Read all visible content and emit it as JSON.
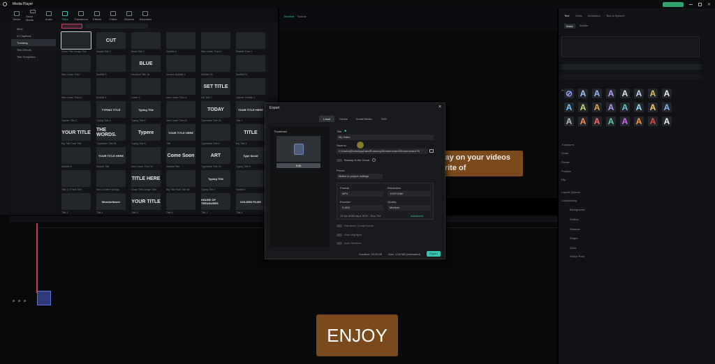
{
  "app": {
    "title": "Media Player"
  },
  "toolbar": [
    "Media",
    "Stock Media",
    "Audio",
    "Titles",
    "Transitions",
    "Effects",
    "Filters",
    "Stickers",
    "Templates"
  ],
  "sidebar": [
    "Mine",
    "AI Captions",
    "Trending",
    "Title Effects",
    "Title Templates"
  ],
  "library": {
    "titles": [
      {
        "t": "",
        "l": "Clean Title Design Title"
      },
      {
        "t": "CUT",
        "l": "Impact Title 1"
      },
      {
        "t": "",
        "l": "Basic Title 2"
      },
      {
        "t": "",
        "l": "Subtitle 4"
      },
      {
        "t": "",
        "l": "New Lower Third 1"
      },
      {
        "t": "",
        "l": "Subtitle Pack 1"
      },
      {
        "t": "",
        "l": "New Lower Third"
      },
      {
        "t": "",
        "l": "Subtitle 3"
      },
      {
        "t": "BLUE",
        "l": "Headline Title 18"
      },
      {
        "t": "",
        "l": "Modern Subtitle 1"
      },
      {
        "t": "",
        "l": "Subtitle 18"
      },
      {
        "t": "",
        "l": "Subtitle 02"
      },
      {
        "t": "",
        "l": "New Lower Third 4"
      },
      {
        "t": "",
        "l": "Subtitle 1"
      },
      {
        "t": "",
        "l": "Lower 3"
      },
      {
        "t": "",
        "l": "New Lower Third 3"
      },
      {
        "t": "SET TITLE",
        "l": "Set Title 1"
      },
      {
        "t": "",
        "l": "Opener Subtitle 1"
      },
      {
        "t": "",
        "l": "Opener Title 1"
      },
      {
        "t": "TYPING TITLE",
        "l": "Typing Title 4"
      },
      {
        "t": "Typing Title",
        "l": "Typing Title 2"
      },
      {
        "t": "",
        "l": "New Lower Third 6"
      },
      {
        "t": "TODAY",
        "l": "Typewriter Title 28"
      },
      {
        "t": "YOUR TITLE HERE",
        "l": "Title 1"
      },
      {
        "t": "YOUR TITLE",
        "l": "Big Title Pack Title"
      },
      {
        "t": "THE WORDS.",
        "l": "Typewriter Title 36"
      },
      {
        "t": "Typere",
        "l": "Typing Title 8"
      },
      {
        "t": "YOUR TITLE HERE",
        "l": "Title"
      },
      {
        "t": "",
        "l": "Typewriter Title 8"
      },
      {
        "t": "TITLE",
        "l": "Big Title 9"
      },
      {
        "t": "",
        "l": "Subtitle 6"
      },
      {
        "t": "YOUR TITLE HERE",
        "l": "Default Title"
      },
      {
        "t": "",
        "l": "New Lower Third 12"
      },
      {
        "t": "Come Soon",
        "l": "Subtitle Title"
      },
      {
        "t": "ART",
        "l": "Typewriter Title 15"
      },
      {
        "t": "Type Scroll",
        "l": "Typing Title 9"
      },
      {
        "t": "",
        "l": "Title 1 Of Text Title"
      },
      {
        "t": "",
        "l": "New Creative Design"
      },
      {
        "t": "TITLE HERE",
        "l": "Clean Title Design Title"
      },
      {
        "t": "",
        "l": "Big Title Pack Title 05"
      },
      {
        "t": "Typing Title",
        "l": "Typing Title 7"
      },
      {
        "t": "",
        "l": "Subtitle 7"
      },
      {
        "t": "",
        "l": "Title 3"
      },
      {
        "t": "Wonderflower",
        "l": "Title 4"
      },
      {
        "t": "YOUR TITLE",
        "l": "Title 5"
      },
      {
        "t": "",
        "l": "Title 6"
      },
      {
        "t": "HOUSE OF TREASURES",
        "l": "Title 7"
      },
      {
        "t": "GOLDEN FILMS",
        "l": "Title 8"
      }
    ]
  },
  "preview": {
    "tabs": [
      "Timeline",
      "Source"
    ],
    "overlay_text": "erlay on your videos\nvorite of"
  },
  "enjoy": "ENJOY",
  "right_panel": {
    "tabs": [
      "Text",
      "Video",
      "Animation",
      "Text to Speech"
    ],
    "subtabs": [
      "Basic",
      "Bubble"
    ],
    "preset_label": "Preset",
    "sections": [
      "Transform",
      "Scale",
      "Rotate",
      "Position",
      "Flip",
      "Layout Options",
      "Compositing",
      "Background",
      "Outline",
      "Shadow",
      "Shape",
      "Glow",
      "Stroke Path"
    ]
  },
  "dialog": {
    "title": "Export",
    "tabs": [
      "Local",
      "Device",
      "Social Media",
      "DVD"
    ],
    "thumbnail_label": "Thumbnail",
    "edit_label": "Edit",
    "title_label": "Title",
    "title_value": "My Video",
    "save_label": "Save to",
    "save_path": "C:/Users/jDmlo/AppData/Roaming/Wondershare/Wondershare Fil",
    "backup_label": "Backup to the Cloud",
    "preset_label": "Preset",
    "preset_value": "Match to project settings",
    "format_label": "Format",
    "format_value": "MP4",
    "resolution_label": "Resolution",
    "resolution_value": "1920*1080",
    "encoder_label": "Encoder",
    "encoder_value": "H.264",
    "quality_label": "Quality",
    "quality_value": "Medium",
    "stats": "25 fps   8085 kbps   SDR - Rec.709",
    "advanced": "Advanced",
    "option1": "Hardware Compression",
    "option2": "Auto Highlight",
    "option3": "Auto Reframe",
    "duration": "Duration: 00:00:05",
    "size": "Size: 4.58 MB (estimated)",
    "export_button": "Export"
  }
}
